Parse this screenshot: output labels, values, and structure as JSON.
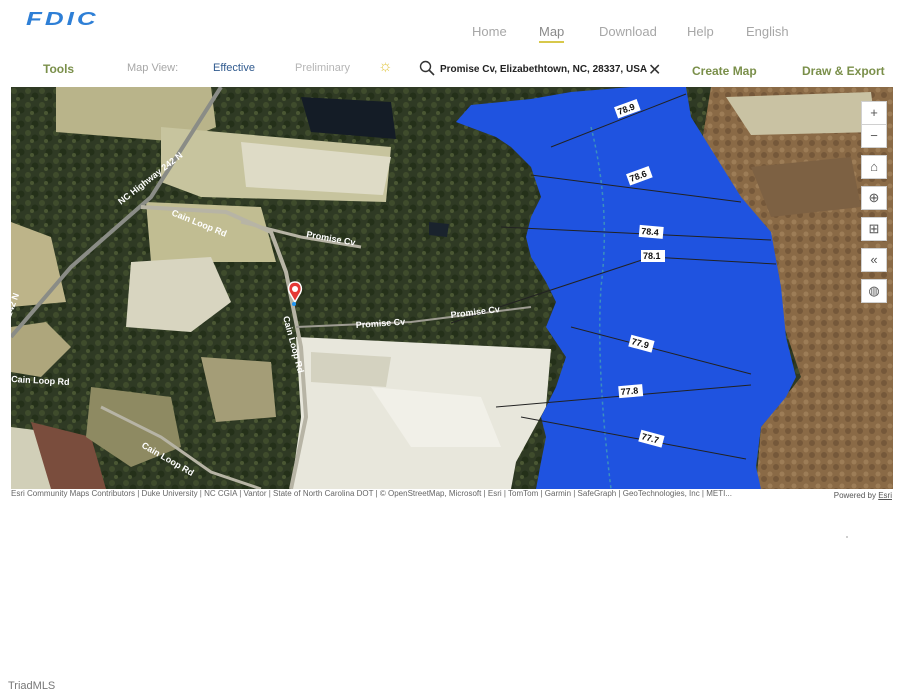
{
  "header": {
    "logo": "FDIC",
    "nav": [
      {
        "label": "Home",
        "active": false
      },
      {
        "label": "Map",
        "active": true
      },
      {
        "label": "Download",
        "active": false
      },
      {
        "label": "Help",
        "active": false
      },
      {
        "label": "English",
        "active": false
      }
    ]
  },
  "toolbar": {
    "tools": "Tools",
    "map_view_label": "Map View:",
    "effective": "Effective",
    "preliminary": "Preliminary",
    "search_value": "Promise Cv, Elizabethtown, NC, 28337, USA",
    "create_map": "Create Map",
    "draw_export": "Draw & Export"
  },
  "map": {
    "road_labels": [
      "NC Highway 242 N",
      "Cain Loop Rd",
      "Promise Cv",
      "Cain Loop Rd",
      "Promise Cv",
      "Promise Cv",
      "Cain Loop Rd",
      "Cain Loop Rd",
      "242 N"
    ],
    "contours": [
      "78.9",
      "78.6",
      "78.4",
      "78.1",
      "77.9",
      "77.8",
      "77.7"
    ],
    "flood_color": "#1f53e0",
    "controls": [
      "zoom-in",
      "zoom-out",
      "home",
      "locate",
      "basemap",
      "collapse",
      "globe"
    ]
  },
  "attribution": "Esri Community Maps Contributors | Duke University | NC CGIA | Vantor | State of North Carolina DOT | © OpenStreetMap, Microsoft | Esri | TomTom | Garmin | SafeGraph | GeoTechnologies, Inc | METI...",
  "powered_by": "Powered by",
  "powered_by_link": "Esri",
  "watermark": "TriadMLS"
}
